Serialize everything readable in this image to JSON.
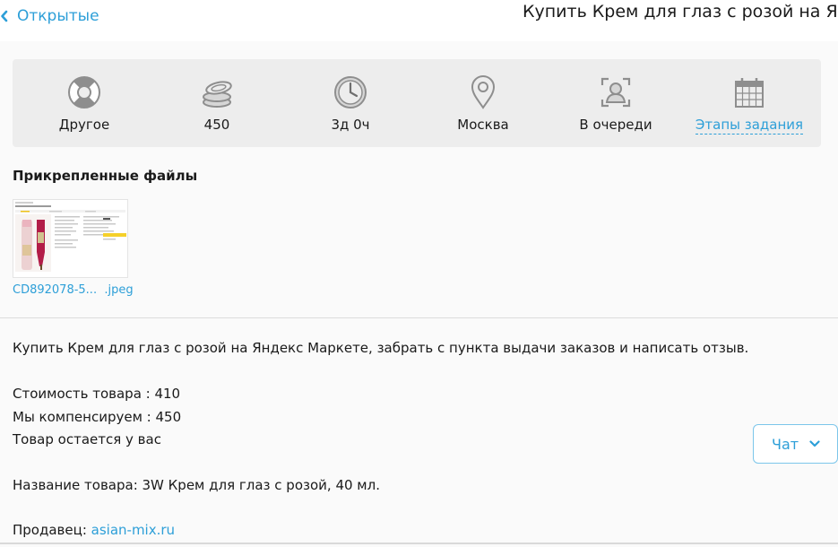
{
  "header": {
    "back_label": "Открытые",
    "title": "Купить Крем для глаз с розой на Янд"
  },
  "stats": [
    {
      "icon": "lifebuoy-icon",
      "label": "Другое"
    },
    {
      "icon": "coins-icon",
      "label": "450"
    },
    {
      "icon": "clock-icon",
      "label": "3д 0ч"
    },
    {
      "icon": "location-pin-icon",
      "label": "Москва"
    },
    {
      "icon": "queue-person-icon",
      "label": "В очереди"
    },
    {
      "icon": "calendar-icon",
      "label": "Этапы задания"
    }
  ],
  "files": {
    "heading": "Прикрепленные файлы",
    "items": [
      {
        "name": "CD892078-5...  .jpeg"
      }
    ]
  },
  "description": {
    "intro": "Купить Крем для глаз с розой на Яндекс Маркете, забрать с пункта выдачи заказов и написать отзыв.",
    "price_line": "Стоимость товара : 410",
    "compensation_line": "Мы компенсируем : 450",
    "keep_line": "Товар остается у вас",
    "product_line": "Название товара: 3W Крем для глаз с розой, 40 мл.",
    "seller_label": "Продавец:",
    "seller_link": "asian-mix.ru"
  },
  "chat": {
    "label": "Чат"
  },
  "colors": {
    "accent": "#2d9fd8",
    "icon_gray": "#8e8e8e",
    "panel_bg": "#ededed"
  }
}
